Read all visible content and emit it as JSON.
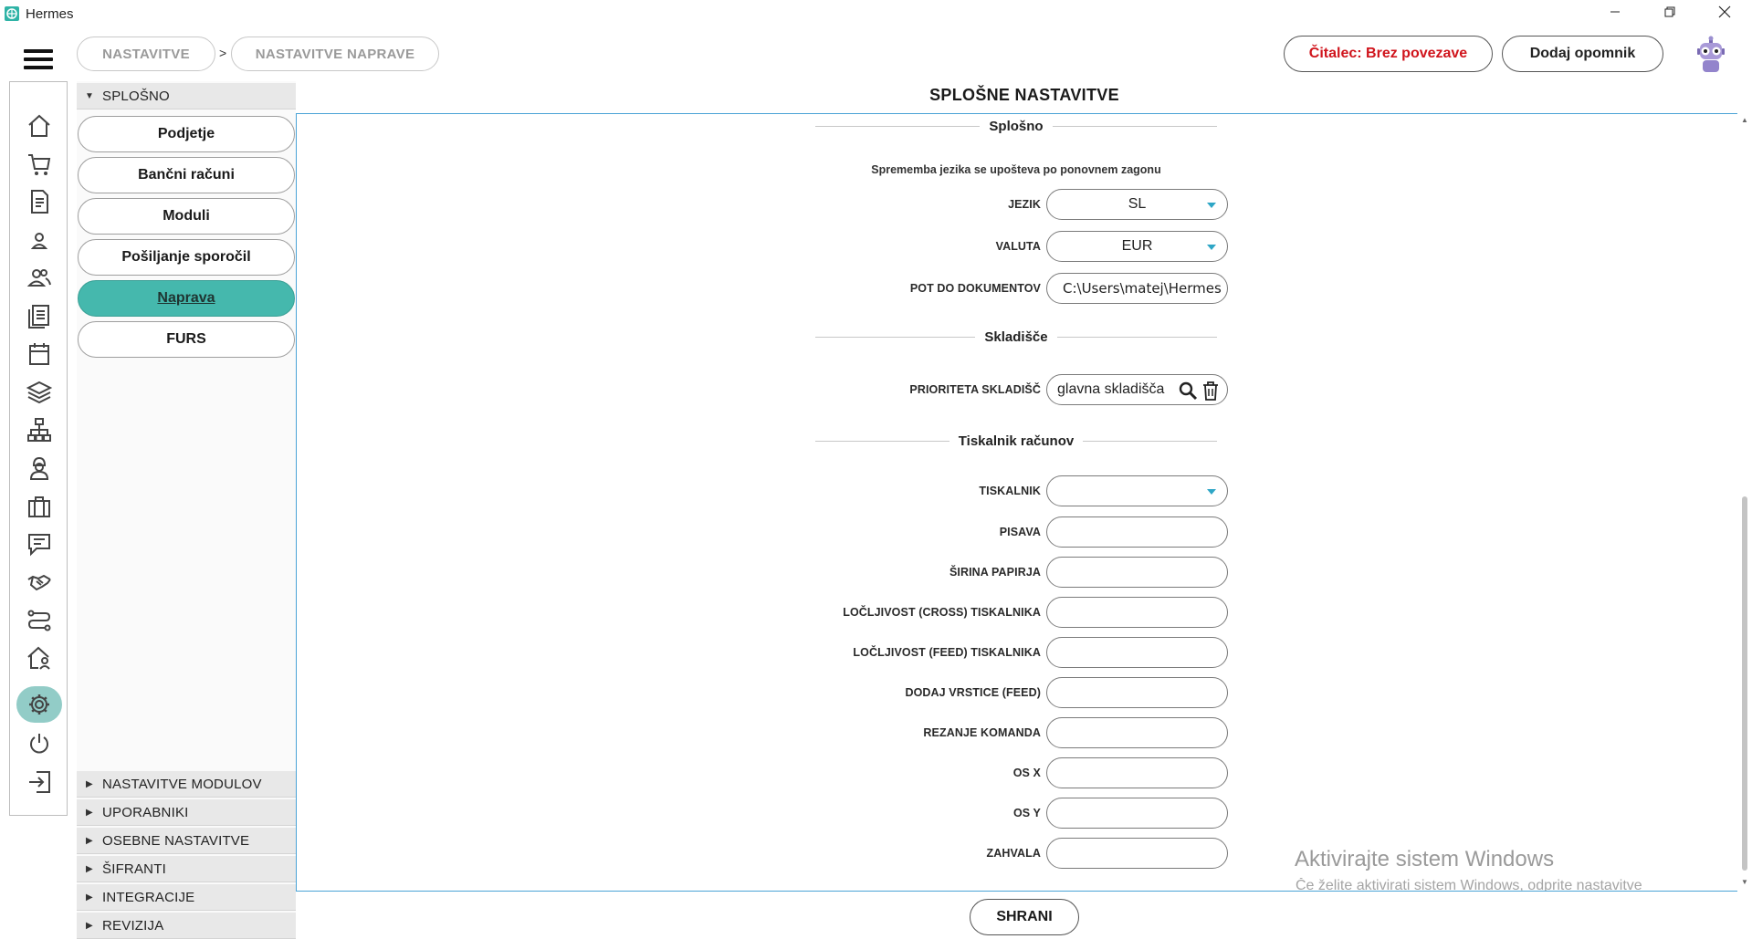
{
  "window": {
    "title": "Hermes",
    "minimize_icon": "minimize-icon",
    "maximize_icon": "restore-icon",
    "close_icon": "close-icon"
  },
  "header": {
    "breadcrumb": [
      "NASTAVITVE",
      "NASTAVITVE NAPRAVE"
    ],
    "breadcrumb_separator": ">",
    "reader_status": "Čitalec: Brez povezave",
    "add_reminder": "Dodaj opomnik",
    "accent_red": "#d0141c"
  },
  "rail_icons": [
    "home-icon",
    "cart-icon",
    "document-icon",
    "user-icon",
    "users-icon",
    "list-icon",
    "calendar-icon",
    "layers-icon",
    "network-icon",
    "worker-icon",
    "briefcase-icon",
    "chat-icon",
    "handshake-icon",
    "routes-icon",
    "house-person-icon",
    "gear-icon",
    "power-icon",
    "logout-icon"
  ],
  "sidebar": {
    "top_group": "SPLOŠNO",
    "items": [
      "Podjetje",
      "Bančni računi",
      "Moduli",
      "Pošiljanje sporočil",
      "Naprava",
      "FURS"
    ],
    "active_item": "Naprava",
    "active_color": "#45b8ad",
    "groups": [
      "NASTAVITVE MODULOV",
      "UPORABNIKI",
      "OSEBNE NASTAVITVE",
      "ŠIFRANTI",
      "INTEGRACIJE",
      "REVIZIJA"
    ]
  },
  "main": {
    "title": "SPLOŠNE NASTAVITVE",
    "sections": {
      "general": "Splošno",
      "warehouse": "Skladišče",
      "printer": "Tiskalnik računov"
    },
    "language_note": "Sprememba jezika se upošteva po ponovnem zagonu",
    "fields": {
      "language": {
        "label": "JEZIK",
        "value": "SL"
      },
      "currency": {
        "label": "VALUTA",
        "value": "EUR"
      },
      "docs_path": {
        "label": "POT DO DOKUMENTOV",
        "value": "C:\\Users\\matej\\Hermes"
      },
      "warehouse_priority": {
        "label": "PRIORITETA SKLADIŠČ",
        "value": "glavna skladišča"
      },
      "printer": {
        "label": "TISKALNIK",
        "value": ""
      },
      "font": {
        "label": "PISAVA",
        "value": ""
      },
      "paper_width": {
        "label": "ŠIRINA PAPIRJA",
        "value": ""
      },
      "cross_res": {
        "label": "LOČLJIVOST (CROSS) TISKALNIKA",
        "value": ""
      },
      "feed_res": {
        "label": "LOČLJIVOST (FEED) TISKALNIKA",
        "value": ""
      },
      "feed_lines": {
        "label": "DODAJ VRSTICE (FEED)",
        "value": ""
      },
      "cut_cmd": {
        "label": "REZANJE KOMANDA",
        "value": ""
      },
      "axis_x": {
        "label": "OS X",
        "value": ""
      },
      "axis_y": {
        "label": "OS Y",
        "value": ""
      },
      "thanks": {
        "label": "ZAHVALA",
        "value": ""
      }
    },
    "save": "SHRANI"
  },
  "watermark": {
    "line1": "Aktivirajte sistem Windows",
    "line2": "Če želite aktivirati sistem Windows, odprite nastavitve"
  }
}
